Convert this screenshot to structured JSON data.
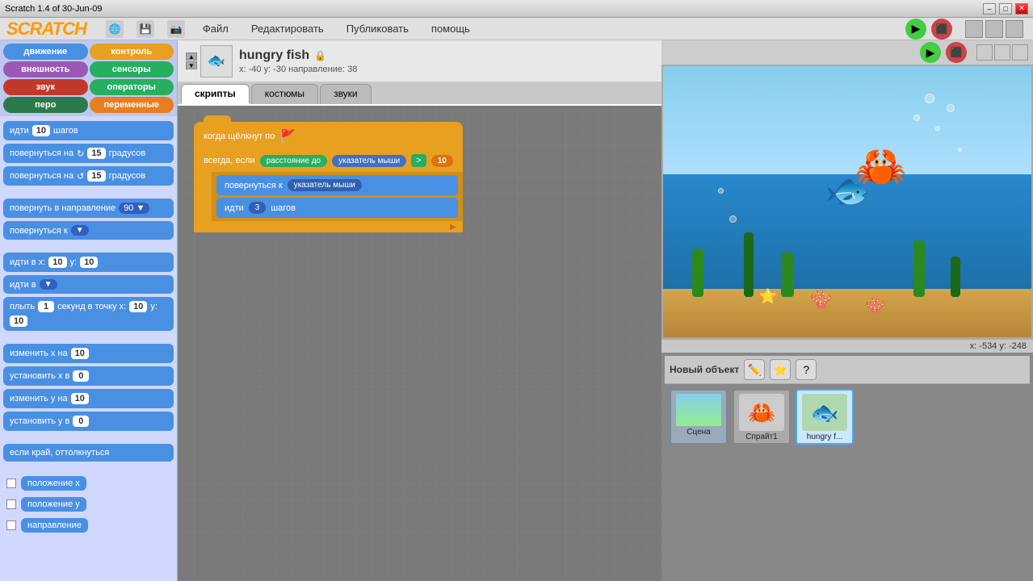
{
  "titlebar": {
    "title": "Scratch 1.4 of 30-Jun-09",
    "minimize": "–",
    "maximize": "□",
    "close": "✕"
  },
  "menubar": {
    "logo": "SCRATCH",
    "menus": [
      "Файл",
      "Редактировать",
      "Публиковать",
      "помощь"
    ]
  },
  "categories": [
    {
      "label": "движение",
      "class": "cat-motion"
    },
    {
      "label": "контроль",
      "class": "cat-control"
    },
    {
      "label": "внешность",
      "class": "cat-looks"
    },
    {
      "label": "сенсоры",
      "class": "cat-sensing"
    },
    {
      "label": "звук",
      "class": "cat-sound"
    },
    {
      "label": "операторы",
      "class": "cat-operators"
    },
    {
      "label": "перо",
      "class": "cat-pen"
    },
    {
      "label": "переменные",
      "class": "cat-variables"
    }
  ],
  "blocks": [
    {
      "text": "идти",
      "num": "10",
      "suffix": "шагов",
      "type": "motion"
    },
    {
      "text": "повернуться на",
      "arrow": "↻",
      "num": "15",
      "suffix": "градусов",
      "type": "motion"
    },
    {
      "text": "повернуться на",
      "arrow": "↺",
      "num": "15",
      "suffix": "градусов",
      "type": "motion"
    },
    {
      "text": "divider"
    },
    {
      "text": "повернуть в направление",
      "num": "90",
      "arrow": "▼",
      "type": "motion"
    },
    {
      "text": "повернуться к",
      "dropdown": "▼",
      "type": "motion"
    },
    {
      "text": "divider"
    },
    {
      "text": "идти в x:",
      "num1": "10",
      "suffix1": "y:",
      "num2": "10",
      "type": "motion"
    },
    {
      "text": "идти в",
      "dropdown": "▼",
      "type": "motion"
    },
    {
      "text": "плыть",
      "num": "1",
      "suffix1": "секунд в точку x:",
      "num2": "10",
      "suffix2": "y:",
      "num3": "10",
      "type": "motion"
    },
    {
      "text": "divider"
    },
    {
      "text": "изменить x на",
      "num": "10",
      "type": "motion"
    },
    {
      "text": "установить x в",
      "num": "0",
      "type": "motion"
    },
    {
      "text": "изменить y на",
      "num": "10",
      "type": "motion"
    },
    {
      "text": "установить y в",
      "num": "0",
      "type": "motion"
    },
    {
      "text": "divider"
    },
    {
      "text": "если край, оттолкнуться",
      "type": "motion"
    },
    {
      "text": "divider"
    },
    {
      "text": "положение x",
      "type": "motion-var"
    },
    {
      "text": "положение y",
      "type": "motion-var"
    },
    {
      "text": "направление",
      "type": "motion-var"
    }
  ],
  "sprite": {
    "name": "hungry fish",
    "x": "-40",
    "y": "-30",
    "direction": "38",
    "coords_label": "x: -40  y: -30  направление: 38"
  },
  "tabs": [
    {
      "label": "скрипты",
      "active": true
    },
    {
      "label": "костюмы",
      "active": false
    },
    {
      "label": "звуки",
      "active": false
    }
  ],
  "scripts": {
    "hat_label": "когда щёлкнут по",
    "forever_label": "всегда, если",
    "sensing_label": "расстояние до",
    "sensing_arg": "указатель мыши",
    "gt_symbol": ">",
    "gt_val": "10",
    "turn_label": "повернуться к",
    "turn_arg": "указатель мыши",
    "move_label": "идти",
    "move_val": "3",
    "move_suffix": "шагов"
  },
  "stage": {
    "coords": "x: -534   y: -248"
  },
  "sprites_panel": {
    "new_label": "Новый объект",
    "tools": [
      "✏️",
      "⭐",
      "?"
    ],
    "sprites": [
      {
        "name": "Спрайт1",
        "emoji": "🦀"
      },
      {
        "name": "hungry f...",
        "emoji": "🐟",
        "selected": true
      }
    ],
    "scenes": [
      {
        "name": "Сцена"
      }
    ]
  }
}
